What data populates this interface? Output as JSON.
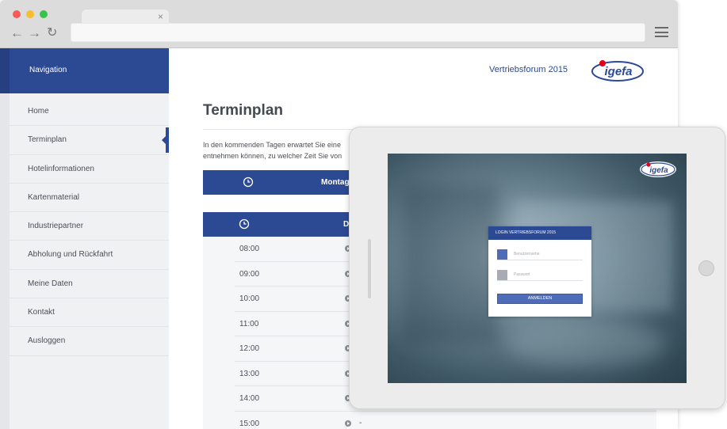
{
  "browser": {
    "tab_close": "×",
    "nav_back": "←",
    "nav_forward": "→",
    "nav_reload": "↻"
  },
  "sidebar": {
    "header": "Navigation",
    "items": [
      {
        "label": "Home"
      },
      {
        "label": "Terminplan",
        "active": true
      },
      {
        "label": "Hotelinformationen"
      },
      {
        "label": "Kartenmaterial"
      },
      {
        "label": "Industriepartner"
      },
      {
        "label": "Abholung und Rückfahrt"
      },
      {
        "label": "Meine Daten"
      },
      {
        "label": "Kontakt"
      },
      {
        "label": "Ausloggen"
      }
    ]
  },
  "header": {
    "event_name": "Vertriebsforum 2015",
    "logo_text": "igefa"
  },
  "main": {
    "title": "Terminplan",
    "intro_line1": "In den kommenden Tagen erwartet Sie eine",
    "intro_line2": "entnehmen können, zu welcher Zeit Sie von",
    "day_label": "Montag",
    "table_head_label": "D",
    "schedule": [
      {
        "time": "08:00",
        "text": ""
      },
      {
        "time": "09:00",
        "text": ""
      },
      {
        "time": "10:00",
        "text": ""
      },
      {
        "time": "11:00",
        "text": ""
      },
      {
        "time": "12:00",
        "text": ""
      },
      {
        "time": "13:00",
        "text": ""
      },
      {
        "time": "14:00",
        "text": ""
      },
      {
        "time": "15:00",
        "text": "-"
      }
    ]
  },
  "tablet": {
    "logo_text": "igefa",
    "login_title": "LOGIN VERTRIEBSFORUM 2015",
    "username_placeholder": "Benutzername",
    "password_placeholder": "Passwort",
    "login_button": "ANMELDEN"
  },
  "colors": {
    "primary": "#2c4a93",
    "accent_red": "#e2001a",
    "button_blue": "#4e6cb8"
  }
}
